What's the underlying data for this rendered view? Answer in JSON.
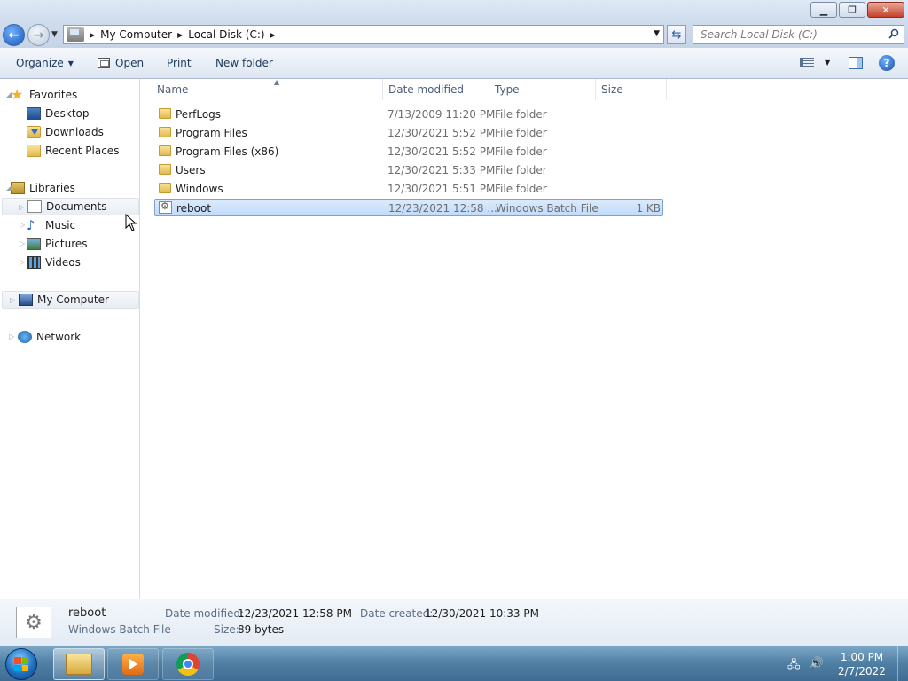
{
  "window": {
    "minimize": "▁",
    "maximize": "❐",
    "close": "✕"
  },
  "address": {
    "crumbs": [
      "My Computer",
      "Local Disk (C:)"
    ],
    "search_placeholder": "Search Local Disk (C:)"
  },
  "toolbar": {
    "organize": "Organize",
    "open": "Open",
    "print": "Print",
    "new_folder": "New folder",
    "help": "?"
  },
  "nav": {
    "favorites": "Favorites",
    "desktop": "Desktop",
    "downloads": "Downloads",
    "recent_places": "Recent Places",
    "libraries": "Libraries",
    "documents": "Documents",
    "music": "Music",
    "pictures": "Pictures",
    "videos": "Videos",
    "my_computer": "My Computer",
    "network": "Network"
  },
  "columns": {
    "name": "Name",
    "date": "Date modified",
    "type": "Type",
    "size": "Size"
  },
  "files": [
    {
      "name": "PerfLogs",
      "date": "7/13/2009 11:20 PM",
      "type": "File folder",
      "size": ""
    },
    {
      "name": "Program Files",
      "date": "12/30/2021 5:52 PM",
      "type": "File folder",
      "size": ""
    },
    {
      "name": "Program Files (x86)",
      "date": "12/30/2021 5:52 PM",
      "type": "File folder",
      "size": ""
    },
    {
      "name": "Users",
      "date": "12/30/2021 5:33 PM",
      "type": "File folder",
      "size": ""
    },
    {
      "name": "Windows",
      "date": "12/30/2021 5:51 PM",
      "type": "File folder",
      "size": ""
    },
    {
      "name": "reboot",
      "date": "12/23/2021 12:58 ...",
      "type": "Windows Batch File",
      "size": "1 KB"
    }
  ],
  "details": {
    "name": "reboot",
    "type": "Windows Batch File",
    "date_modified_label": "Date modified:",
    "date_modified": "12/23/2021 12:58 PM",
    "date_created_label": "Date created:",
    "date_created": "12/30/2021 10:33 PM",
    "size_label": "Size:",
    "size": "89 bytes"
  },
  "taskbar": {
    "time": "1:00 PM",
    "date": "2/7/2022"
  }
}
